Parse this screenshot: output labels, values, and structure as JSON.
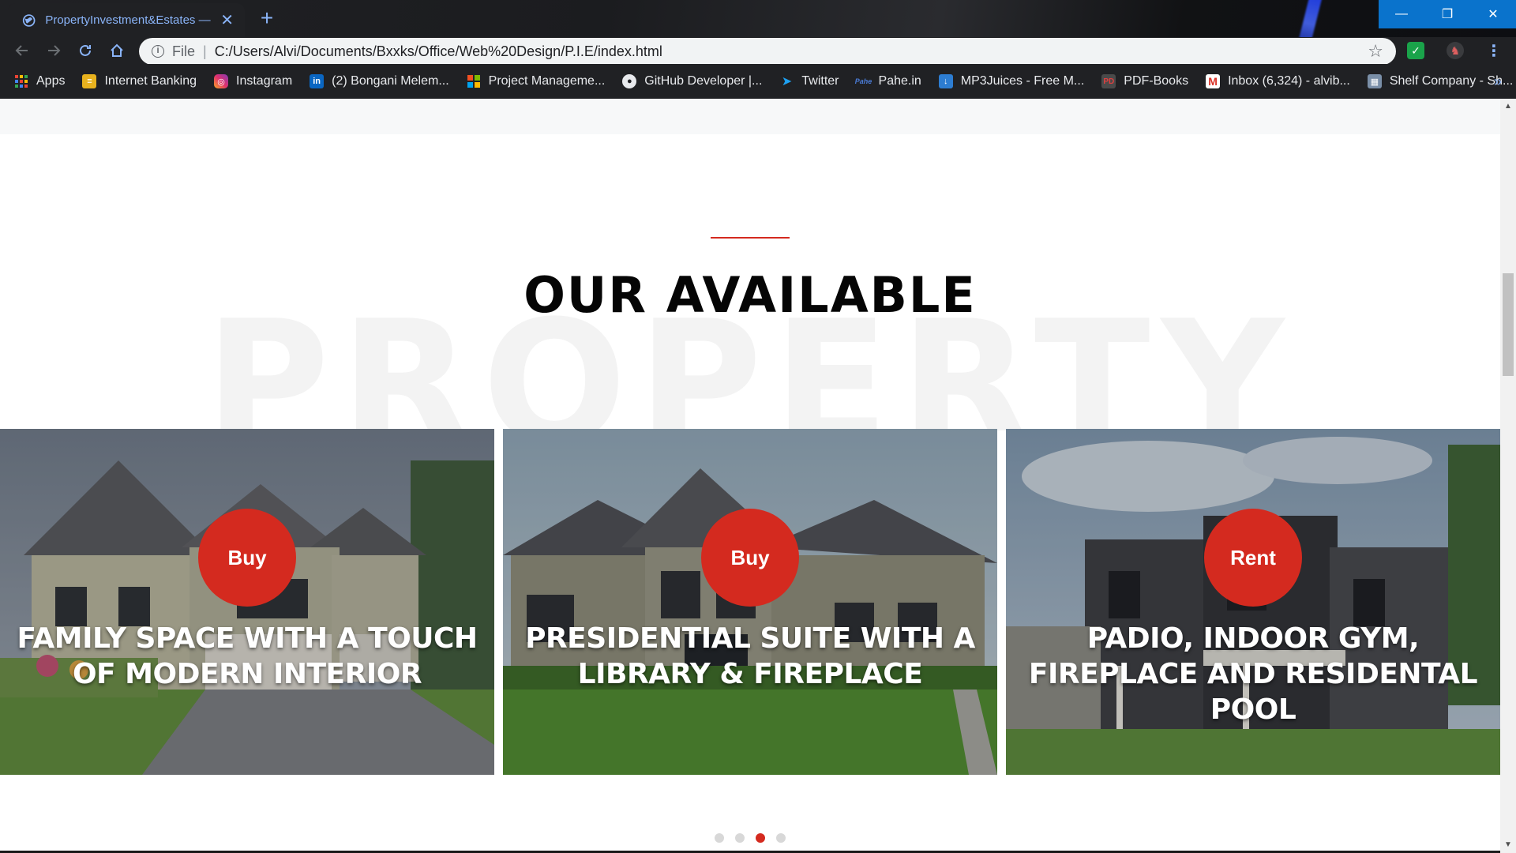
{
  "browser": {
    "tab_title": "PropertyInvestment&Estates —h",
    "tab_close": "✕",
    "new_tab": "+",
    "window_minimize": "—",
    "window_restore": "❐",
    "window_close": "✕",
    "omnibox": {
      "scheme_label": "File",
      "separator": "|",
      "url": "C:/Users/Alvi/Documents/Bxxks/Office/Web%20Design/P.I.E/index.html",
      "star": "☆"
    },
    "bookmarks": [
      {
        "label": "Apps",
        "icon": "apps-grid-icon"
      },
      {
        "label": "Internet Banking",
        "icon": "bank-icon"
      },
      {
        "label": "Instagram",
        "icon": "instagram-icon"
      },
      {
        "label": "(2) Bongani Melem...",
        "icon": "linkedin-icon"
      },
      {
        "label": "Project Manageme...",
        "icon": "microsoft-icon"
      },
      {
        "label": "GitHub Developer |...",
        "icon": "github-icon"
      },
      {
        "label": "Twitter",
        "icon": "twitter-icon"
      },
      {
        "label": "Pahe.in",
        "icon": "pahe-icon"
      },
      {
        "label": "MP3Juices - Free M...",
        "icon": "download-icon"
      },
      {
        "label": "PDF-Books",
        "icon": "pdf-icon"
      },
      {
        "label": "Inbox (6,324) - alvib...",
        "icon": "gmail-icon"
      },
      {
        "label": "Shelf Company - Sh...",
        "icon": "building-icon"
      }
    ],
    "bookmarks_more": "»"
  },
  "page": {
    "section_title": "OUR AVAILABLE",
    "watermark": "PROPERTY",
    "cards": [
      {
        "badge": "Buy",
        "title": "FAMILY SPACE WITH A TOUCH OF MODERN INTERIOR"
      },
      {
        "badge": "Buy",
        "title": "PRESIDENTIAL SUITE WITH A LIBRARY & FIREPLACE"
      },
      {
        "badge": "Rent",
        "title": "PADIO, INDOOR GYM, FIREPLACE AND RESIDENTAL POOL"
      }
    ],
    "carousel": {
      "total_dots": 4,
      "active_index": 2
    }
  },
  "colors": {
    "accent_red": "#d42a1f",
    "chrome_dark": "#202124",
    "link_blue": "#8ab4f8",
    "window_blue": "#0a73cc"
  }
}
